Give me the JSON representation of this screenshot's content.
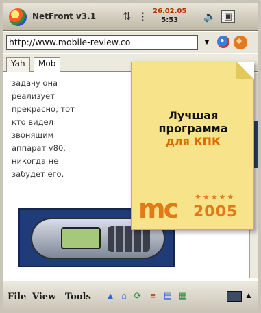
{
  "titlebar": {
    "app_title": "NetFront v3.1",
    "clock_date": "26.02.05",
    "clock_time": "5:53",
    "icons": [
      "start-icon",
      "connectivity-icon",
      "volume-icon",
      "close-icon"
    ]
  },
  "addressbar": {
    "url": "http://www.mobile-review.co",
    "dropdown_icon": "chevron-down-icon",
    "icons": [
      "globe-icon",
      "go-icon"
    ]
  },
  "tabs": [
    {
      "label": "Yah"
    },
    {
      "label": "Mob"
    }
  ],
  "article": {
    "lines": [
      "задачу она",
      "реализует",
      "прекрасно, тот",
      "кто видел",
      "звонящим",
      "аппарат v80,",
      "никогда не",
      "забудет его."
    ]
  },
  "note": {
    "line1": "Лучшая",
    "line2": "программа",
    "line3": "для КПК",
    "logo_text": "mc",
    "logo_year": "2005",
    "logo_stars": "★★★★★"
  },
  "menubar": {
    "items": [
      {
        "label": "File"
      },
      {
        "label": "View"
      },
      {
        "label": "Tools"
      }
    ],
    "icons": [
      "bookmark-icon",
      "home-icon",
      "refresh-icon",
      "history-icon",
      "save-icon",
      "screen-icon",
      "keyboard-icon",
      "up-arrow-icon"
    ]
  },
  "colors": {
    "note_bg": "#f6e38a",
    "note_accent": "#e06a00",
    "logo": "#e27a18",
    "scroll_thumb": "#2c3f66"
  }
}
